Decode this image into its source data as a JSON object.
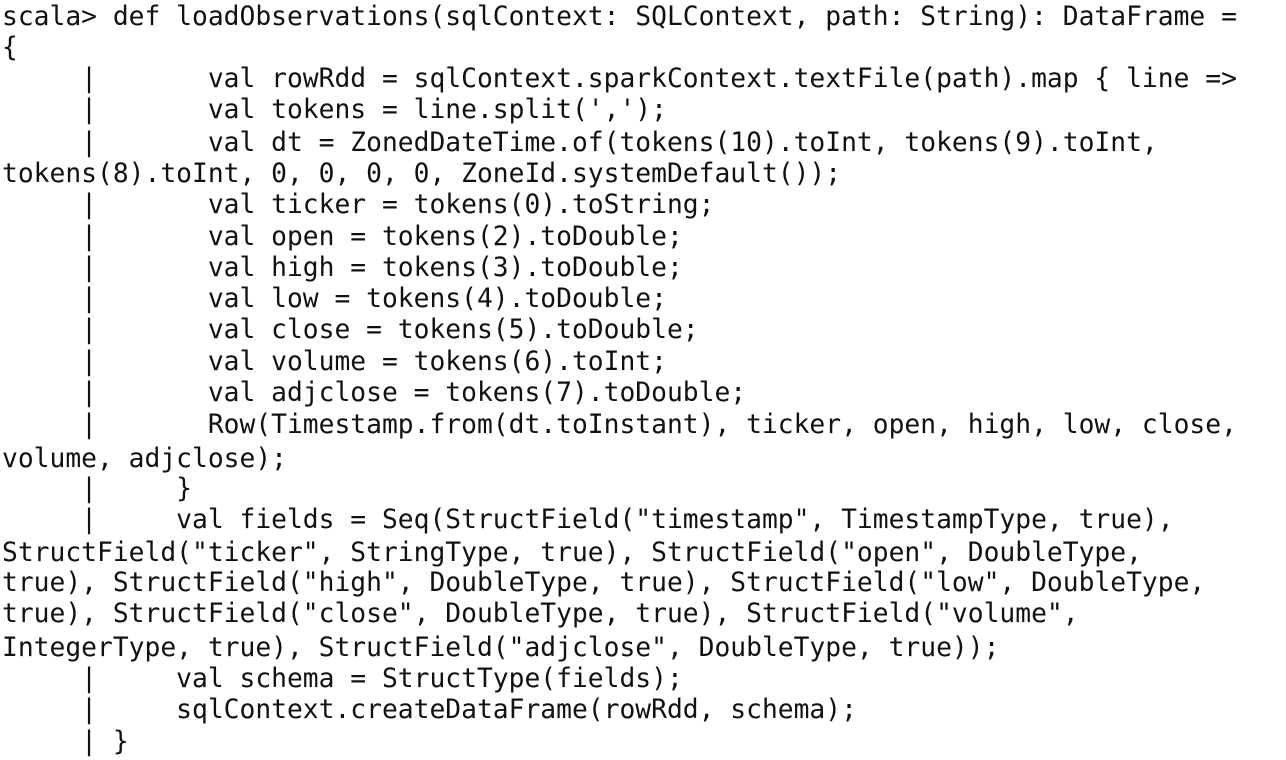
{
  "terminal": {
    "lines": [
      "scala> def loadObservations(sqlContext: SQLContext, path: String): DataFrame =",
      "{",
      "     |       val rowRdd = sqlContext.sparkContext.textFile(path).map { line =>",
      "     |       val tokens = line.split(',');",
      "     |       val dt = ZonedDateTime.of(tokens(10).toInt, tokens(9).toInt,",
      "tokens(8).toInt, 0, 0, 0, 0, ZoneId.systemDefault());",
      "     |       val ticker = tokens(0).toString;",
      "     |       val open = tokens(2).toDouble;",
      "     |       val high = tokens(3).toDouble;",
      "     |       val low = tokens(4).toDouble;",
      "     |       val close = tokens(5).toDouble;",
      "     |       val volume = tokens(6).toInt;",
      "     |       val adjclose = tokens(7).toDouble;",
      "     |       Row(Timestamp.from(dt.toInstant), ticker, open, high, low, close,",
      "volume, adjclose);",
      "     |     }",
      "     |     val fields = Seq(StructField(\"timestamp\", TimestampType, true),",
      "StructField(\"ticker\", StringType, true), StructField(\"open\", DoubleType,",
      "true), StructField(\"high\", DoubleType, true), StructField(\"low\", DoubleType,",
      "true), StructField(\"close\", DoubleType, true), StructField(\"volume\",",
      "IntegerType, true), StructField(\"adjclose\", DoubleType, true));",
      "     |     val schema = StructType(fields);",
      "     |     sqlContext.createDataFrame(rowRdd, schema);",
      "     | }"
    ]
  }
}
